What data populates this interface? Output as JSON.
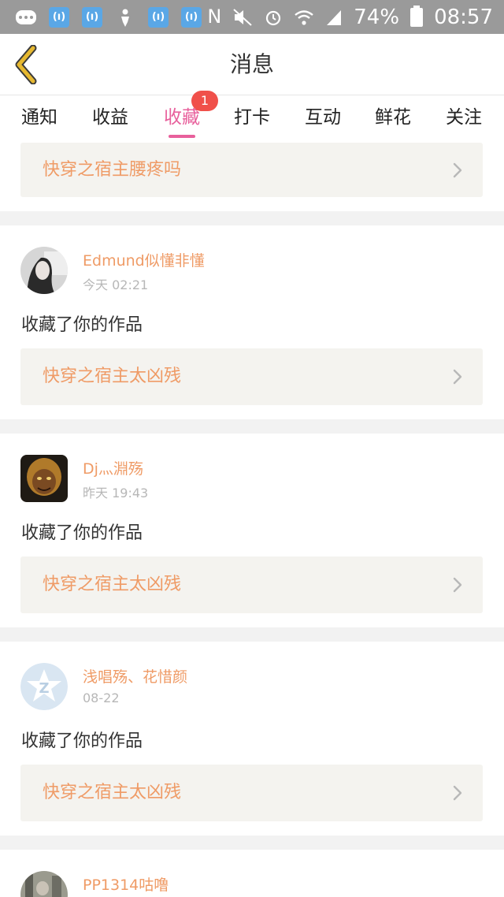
{
  "status_bar": {
    "battery": "74%",
    "time": "08:57",
    "notification_icons": [
      "chat-icon",
      "signal-app-icon",
      "signal-app-icon",
      "figure-icon",
      "signal-app-icon",
      "signal-app-icon"
    ],
    "blue_icon_glyph": "(ı)"
  },
  "header": {
    "back_icon": "chevron-left-icon",
    "title": "消息"
  },
  "tabs": [
    {
      "label": "通知",
      "active": false
    },
    {
      "label": "收益",
      "active": false
    },
    {
      "label": "收藏",
      "active": true,
      "badge": "1"
    },
    {
      "label": "打卡",
      "active": false
    },
    {
      "label": "互动",
      "active": false
    },
    {
      "label": "鲜花",
      "active": false
    },
    {
      "label": "关注",
      "active": false
    }
  ],
  "feed": {
    "first_work_title": "快穿之宿主腰疼吗",
    "items": [
      {
        "username": "Edmund似懂非懂",
        "time": "今天 02:21",
        "action": "收藏了你的作品",
        "work_title": "快穿之宿主太凶残"
      },
      {
        "username": "Dj灬淵殇",
        "time": "昨天 19:43",
        "action": "收藏了你的作品",
        "work_title": "快穿之宿主太凶残"
      },
      {
        "username": "浅唱殇、花惜颜",
        "time": "08-22",
        "action": "收藏了你的作品",
        "work_title": "快穿之宿主太凶残"
      },
      {
        "username": "PP1314咕噜"
      }
    ]
  },
  "colors": {
    "accent_pink": "#e8609c",
    "link_orange": "#ef9b66",
    "badge_red": "#f0504a",
    "back_arrow": "#e6b830"
  }
}
